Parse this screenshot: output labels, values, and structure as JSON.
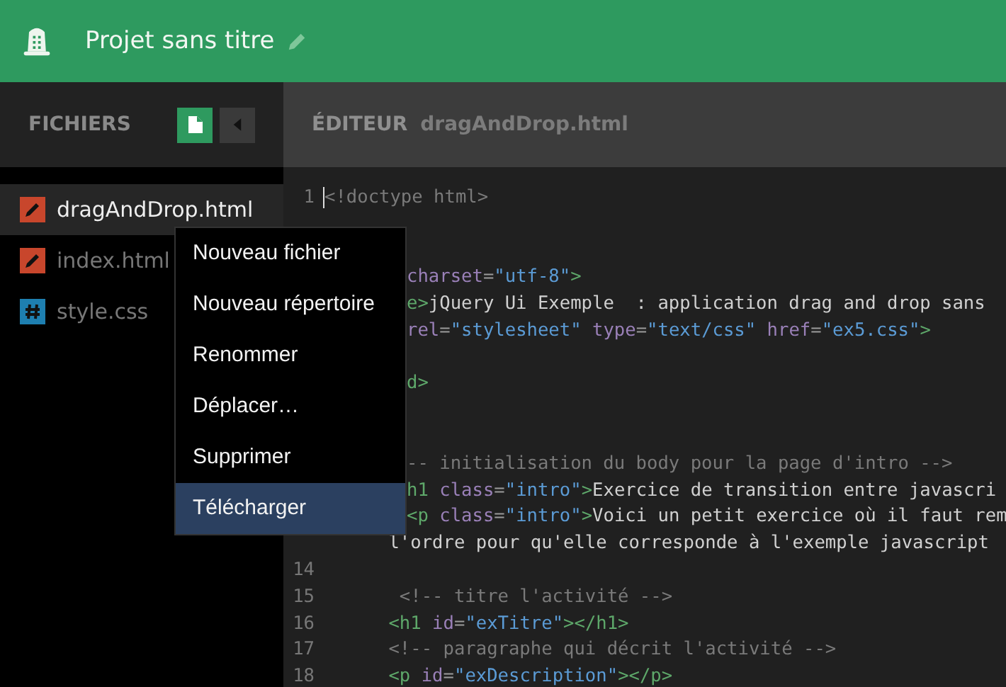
{
  "app_bar": {
    "title": "Projet sans titre"
  },
  "sidebar": {
    "title": "FICHIERS",
    "files": [
      {
        "name": "dragAndDrop.html",
        "kind": "html",
        "selected": true
      },
      {
        "name": "index.html",
        "kind": "html",
        "selected": false
      },
      {
        "name": "style.css",
        "kind": "css",
        "selected": false
      }
    ]
  },
  "editor": {
    "label": "ÉDITEUR",
    "filename": "dragAndDrop.html",
    "lines": [
      {
        "kind": "code",
        "number": "1",
        "segments": [
          {
            "kind": "comment",
            "text": "<!doctype html>"
          }
        ]
      },
      {
        "kind": "blank"
      },
      {
        "kind": "blank"
      },
      {
        "kind": "code",
        "covered": true,
        "segments": [
          {
            "kind": "attr",
            "text": "charset"
          },
          {
            "kind": "punct",
            "text": "="
          },
          {
            "kind": "string",
            "text": "\"utf-8\""
          },
          {
            "kind": "tag",
            "text": ">"
          }
        ]
      },
      {
        "kind": "code",
        "covered": true,
        "segments": [
          {
            "kind": "tag",
            "text": "e>"
          },
          {
            "kind": "text",
            "text": "jQuery Ui Exemple  : application drag and drop sans"
          }
        ]
      },
      {
        "kind": "code",
        "covered": true,
        "segments": [
          {
            "kind": "attr",
            "text": "rel"
          },
          {
            "kind": "punct",
            "text": "="
          },
          {
            "kind": "string",
            "text": "\"stylesheet\""
          },
          {
            "kind": "attr",
            "text": " type"
          },
          {
            "kind": "punct",
            "text": "="
          },
          {
            "kind": "string",
            "text": "\"text/css\""
          },
          {
            "kind": "attr",
            "text": " href"
          },
          {
            "kind": "punct",
            "text": "="
          },
          {
            "kind": "string",
            "text": "\"ex5.css\""
          },
          {
            "kind": "tag",
            "text": ">"
          }
        ]
      },
      {
        "kind": "blank"
      },
      {
        "kind": "code",
        "covered": true,
        "segments": [
          {
            "kind": "tag",
            "text": "d>"
          }
        ]
      },
      {
        "kind": "blank"
      },
      {
        "kind": "blank"
      },
      {
        "kind": "code",
        "covered": true,
        "segments": [
          {
            "kind": "comment",
            "text": "-- initialisation du body pour la page d'intro -->"
          }
        ]
      },
      {
        "kind": "code",
        "covered": true,
        "segments": [
          {
            "kind": "tag",
            "text": "h1"
          },
          {
            "kind": "attr",
            "text": " class"
          },
          {
            "kind": "punct",
            "text": "="
          },
          {
            "kind": "string",
            "text": "\"intro\""
          },
          {
            "kind": "tag",
            "text": ">"
          },
          {
            "kind": "text",
            "text": "Exercice de transition entre javascri"
          }
        ]
      },
      {
        "kind": "code",
        "covered": true,
        "segments": [
          {
            "kind": "tag",
            "text": "<p"
          },
          {
            "kind": "attr",
            "text": " class"
          },
          {
            "kind": "punct",
            "text": "="
          },
          {
            "kind": "string",
            "text": "\"intro\""
          },
          {
            "kind": "tag",
            "text": ">"
          },
          {
            "kind": "text",
            "text": "Voici un petit exercice où il faut rem"
          }
        ]
      },
      {
        "kind": "code",
        "segments": [
          {
            "kind": "text",
            "text": "      l'ordre pour qu'elle corresponde à l'exemple javascript"
          }
        ]
      },
      {
        "kind": "blank",
        "number": "14"
      },
      {
        "kind": "code",
        "number": "15",
        "segments": [
          {
            "kind": "comment",
            "text": "       <!-- titre l'activité -->"
          }
        ]
      },
      {
        "kind": "code",
        "number": "16",
        "segments": [
          {
            "kind": "tag",
            "text": "      <h1"
          },
          {
            "kind": "attr",
            "text": " id"
          },
          {
            "kind": "punct",
            "text": "="
          },
          {
            "kind": "string",
            "text": "\"exTitre\""
          },
          {
            "kind": "tag",
            "text": "></h1>"
          }
        ]
      },
      {
        "kind": "code",
        "number": "17",
        "segments": [
          {
            "kind": "comment",
            "text": "      <!-- paragraphe qui décrit l'activité -->"
          }
        ]
      },
      {
        "kind": "code",
        "number": "18",
        "segments": [
          {
            "kind": "tag",
            "text": "      <p"
          },
          {
            "kind": "attr",
            "text": " id"
          },
          {
            "kind": "punct",
            "text": "="
          },
          {
            "kind": "string",
            "text": "\"exDescription\""
          },
          {
            "kind": "tag",
            "text": "></p>"
          }
        ]
      }
    ]
  },
  "context_menu": {
    "items": [
      {
        "label": "Nouveau fichier",
        "selected": false
      },
      {
        "label": "Nouveau répertoire",
        "selected": false
      },
      {
        "label": "Renommer",
        "selected": false
      },
      {
        "label": "Déplacer…",
        "selected": false
      },
      {
        "label": "Supprimer",
        "selected": false
      },
      {
        "label": "Télécharger",
        "selected": true
      }
    ]
  }
}
